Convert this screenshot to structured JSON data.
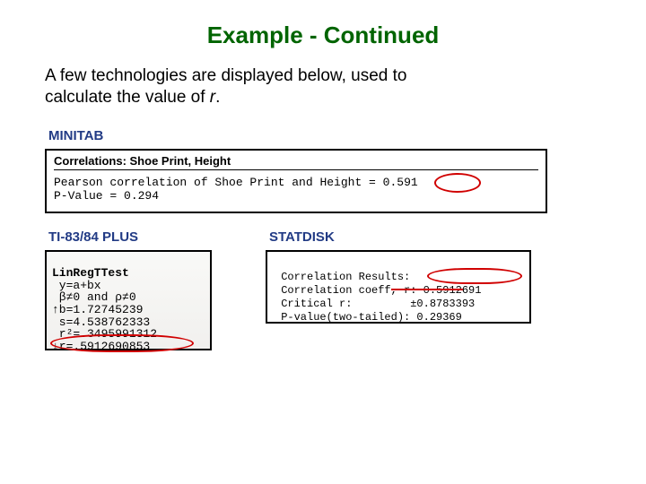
{
  "title": "Example - Continued",
  "intro_1": "A few technologies are displayed below, used to",
  "intro_2": "calculate the value of ",
  "intro_r": "r",
  "intro_3": ".",
  "minitab": {
    "label": "MINITAB",
    "header": "Correlations: Shoe Print, Height",
    "line1_pre": "Pearson correlation of Shoe Print and Height = ",
    "line1_val": "0.591",
    "line2": "P-Value = 0.294"
  },
  "ti": {
    "label": "TI-83/84 PLUS",
    "line1": "LinRegTTest",
    "line2": " y=a+bx",
    "line3": " β≠0 and ρ≠0",
    "line4": "↑b=1.72745239",
    "line5": " s=4.538762333",
    "line6": " r²=.3495991312",
    "line7": "↓r=.5912690853"
  },
  "statdisk": {
    "label": "STATDISK",
    "line1": " Correlation Results:",
    "line2_pre": " Correlation coeff, ",
    "line2_val": "r: 0.5912691",
    "line3": " Critical r:         ±0.8783393",
    "line4": " P-value(two-tailed): 0.29369"
  }
}
